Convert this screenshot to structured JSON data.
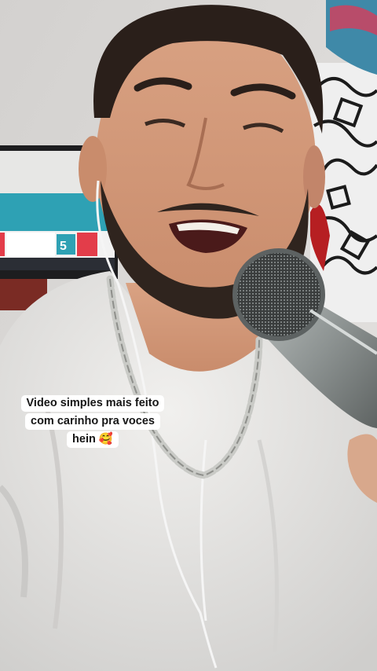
{
  "caption": {
    "line1": "Video simples mais feito",
    "line2": "com carinho pra voces",
    "line3": "hein 🥰"
  },
  "colors": {
    "wall": "#d9d8d6",
    "tv_screen": "#2ea1b4",
    "shirt": "#e9e8e6",
    "skin": "#d69a78",
    "hair": "#2a1f1a",
    "microphone": "#9ea3a3",
    "chain": "#c9cac6"
  }
}
